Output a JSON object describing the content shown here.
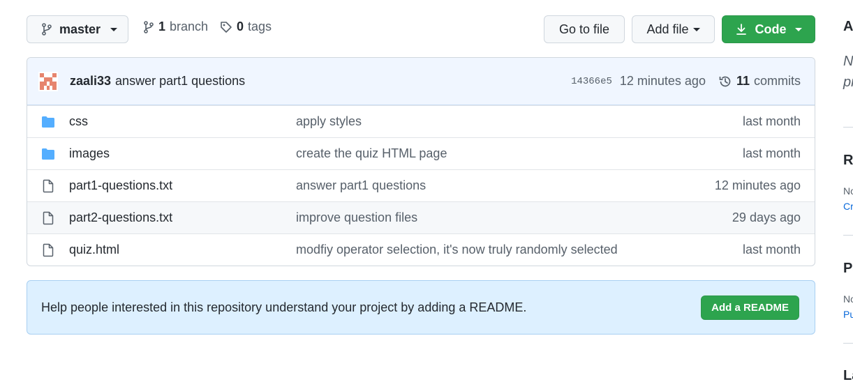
{
  "toolbar": {
    "branch_name": "master",
    "branches_count": "1",
    "branches_label": "branch",
    "tags_count": "0",
    "tags_label": "tags",
    "go_to_file": "Go to file",
    "add_file": "Add file",
    "code": "Code"
  },
  "latest_commit": {
    "author": "zaali33",
    "message": "answer part1 questions",
    "sha": "14366e5",
    "time": "12 minutes ago",
    "commits_count": "11",
    "commits_label": "commits"
  },
  "files": [
    {
      "type": "folder",
      "icon": "folder-icon",
      "name": "css",
      "message": "apply styles",
      "date": "last month"
    },
    {
      "type": "folder",
      "icon": "folder-icon",
      "name": "images",
      "message": "create the quiz HTML page",
      "date": "last month"
    },
    {
      "type": "file",
      "icon": "file-icon",
      "name": "part1-questions.txt",
      "message": "answer part1 questions",
      "date": "12 minutes ago"
    },
    {
      "type": "file",
      "icon": "file-icon",
      "name": "part2-questions.txt",
      "message": "improve question files",
      "date": "29 days ago"
    },
    {
      "type": "file",
      "icon": "file-icon",
      "name": "quiz.html",
      "message": "modfiy operator selection, it's now truly randomly selected",
      "date": "last month"
    }
  ],
  "readme_banner": {
    "text": "Help people interested in this repository understand your project by adding a README.",
    "button": "Add a README"
  },
  "sidebar": {
    "about_heading": "A",
    "about_line1": "N",
    "about_line2": "pr",
    "releases_heading": "Re",
    "releases_line1": "No",
    "releases_link": "Cr",
    "packages_heading": "Pa",
    "packages_line1": "No",
    "packages_link": "Pu",
    "languages_heading": "La"
  },
  "colors": {
    "primary_green": "#2da44e",
    "folder_blue": "#54aeff",
    "banner_blue": "#ddf0ff"
  }
}
